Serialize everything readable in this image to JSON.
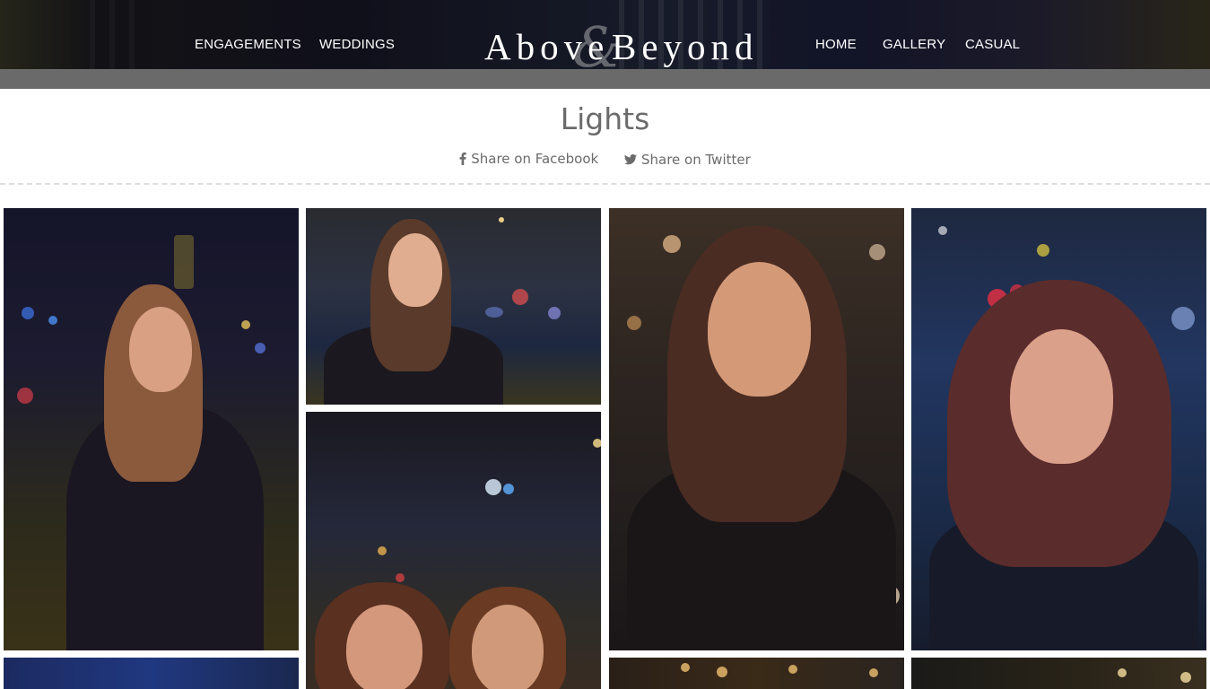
{
  "header": {
    "nav_left": [
      "ENGAGEMENTS",
      "WEDDINGS"
    ],
    "nav_right": [
      "HOME",
      "GALLERY",
      "CASUAL"
    ],
    "logo": {
      "word1": "Above",
      "amp": "&",
      "word2": "Beyond"
    }
  },
  "page": {
    "title": "Lights",
    "share_facebook": "Share on Facebook",
    "share_twitter": "Share on Twitter"
  },
  "icons": {
    "facebook": "facebook-icon",
    "twitter": "twitter-icon"
  },
  "colors": {
    "header_bg": "#1d1e2c",
    "subbar": "#6a6a6a",
    "text": "#6b6b6b",
    "divider": "#dddddd"
  }
}
